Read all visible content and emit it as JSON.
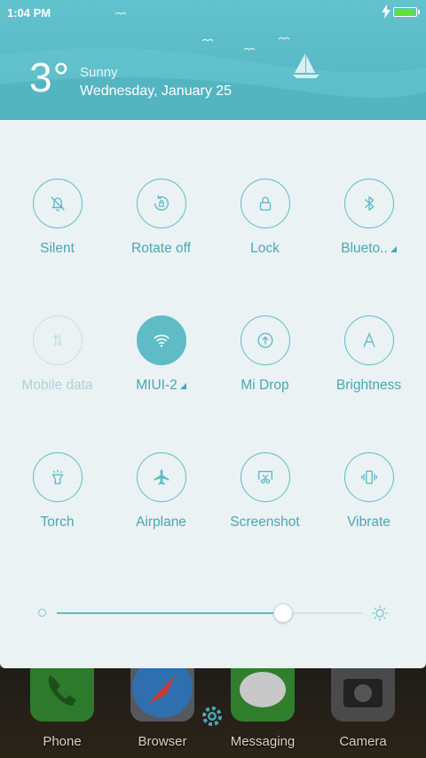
{
  "status_bar": {
    "time": "1:04 PM",
    "battery_level": 1.0,
    "charging": true
  },
  "weather": {
    "temperature": "3°",
    "condition": "Sunny",
    "date": "Wednesday, January 25"
  },
  "toggles": [
    {
      "label": "Silent",
      "icon": "bell-off-icon",
      "state": "off"
    },
    {
      "label": "Rotate off",
      "icon": "rotate-lock-icon",
      "state": "off"
    },
    {
      "label": "Lock",
      "icon": "lock-icon",
      "state": "off"
    },
    {
      "label": "Blueto..",
      "icon": "bluetooth-icon",
      "state": "off",
      "has_more": true
    },
    {
      "label": "Mobile data",
      "icon": "mobile-data-icon",
      "state": "disabled"
    },
    {
      "label": "MIUI-2",
      "icon": "wifi-icon",
      "state": "on",
      "has_more": true
    },
    {
      "label": "Mi Drop",
      "icon": "mi-drop-icon",
      "state": "off"
    },
    {
      "label": "Brightness",
      "icon": "auto-brightness-icon",
      "state": "off"
    },
    {
      "label": "Torch",
      "icon": "torch-icon",
      "state": "off"
    },
    {
      "label": "Airplane",
      "icon": "airplane-icon",
      "state": "off"
    },
    {
      "label": "Screenshot",
      "icon": "screenshot-icon",
      "state": "off"
    },
    {
      "label": "Vibrate",
      "icon": "vibrate-icon",
      "state": "off"
    }
  ],
  "brightness": {
    "level": 0.74
  },
  "dock": [
    {
      "label": "Phone",
      "icon": "phone-icon"
    },
    {
      "label": "Browser",
      "icon": "compass-icon"
    },
    {
      "label": "Messaging",
      "icon": "chat-bubble-icon"
    },
    {
      "label": "Camera",
      "icon": "camera-icon"
    }
  ],
  "colors": {
    "accent": "#5fbcc6",
    "text": "#4aa7b2",
    "panel": "#eaf2f4",
    "header": "#5ebdc8"
  }
}
